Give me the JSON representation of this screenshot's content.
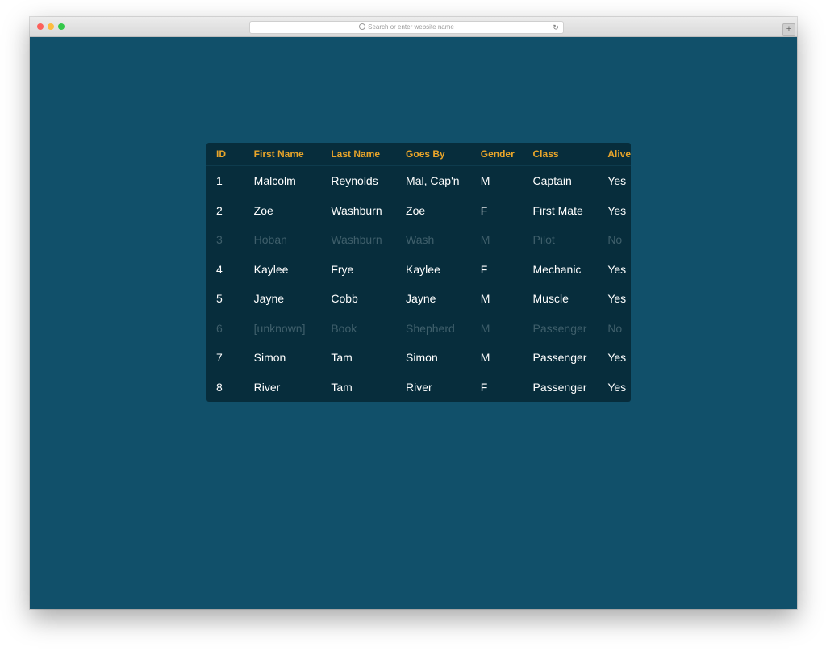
{
  "browser": {
    "address_placeholder": "Search or enter website name",
    "reload_icon": "reload-icon",
    "new_tab_symbol": "+"
  },
  "table": {
    "headers": [
      "ID",
      "First Name",
      "Last Name",
      "Goes By",
      "Gender",
      "Class",
      "Alive"
    ],
    "rows": [
      {
        "id": "1",
        "first": "Malcolm",
        "last": "Reynolds",
        "goes_by": "Mal, Cap'n",
        "gender": "M",
        "class": "Captain",
        "alive": "Yes"
      },
      {
        "id": "2",
        "first": "Zoe",
        "last": "Washburn",
        "goes_by": "Zoe",
        "gender": "F",
        "class": "First Mate",
        "alive": "Yes"
      },
      {
        "id": "3",
        "first": "Hoban",
        "last": "Washburn",
        "goes_by": "Wash",
        "gender": "M",
        "class": "Pilot",
        "alive": "No"
      },
      {
        "id": "4",
        "first": "Kaylee",
        "last": "Frye",
        "goes_by": "Kaylee",
        "gender": "F",
        "class": "Mechanic",
        "alive": "Yes"
      },
      {
        "id": "5",
        "first": "Jayne",
        "last": "Cobb",
        "goes_by": "Jayne",
        "gender": "M",
        "class": "Muscle",
        "alive": "Yes"
      },
      {
        "id": "6",
        "first": "[unknown]",
        "last": "Book",
        "goes_by": "Shepherd",
        "gender": "M",
        "class": "Passenger",
        "alive": "No"
      },
      {
        "id": "7",
        "first": "Simon",
        "last": "Tam",
        "goes_by": "Simon",
        "gender": "M",
        "class": "Passenger",
        "alive": "Yes"
      },
      {
        "id": "8",
        "first": "River",
        "last": "Tam",
        "goes_by": "River",
        "gender": "F",
        "class": "Passenger",
        "alive": "Yes"
      }
    ]
  },
  "colors": {
    "page_background": "#11506a",
    "table_background": "#072d3c",
    "header_text": "#e9a52a",
    "row_text": "#ffffff",
    "dead_row_text": "#3f5f6b"
  }
}
